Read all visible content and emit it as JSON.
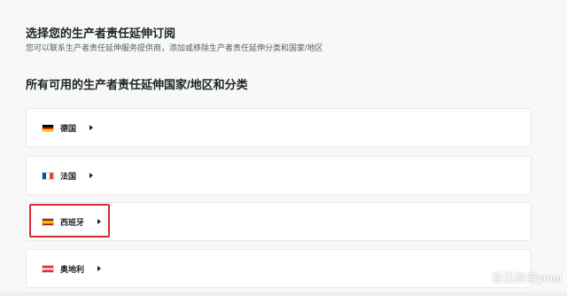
{
  "header": {
    "title": "选择您的生产者责任延伸订阅",
    "subtitle": "您可以联系生产者责任延伸服务提供商，添加或移除生产者责任延伸分类和国家/地区"
  },
  "section": {
    "title": "所有可用的生产者责任延伸国家/地区和分类"
  },
  "countries": [
    {
      "label": "德国",
      "flag": "germany-flag-icon"
    },
    {
      "label": "法国",
      "flag": "france-flag-icon"
    },
    {
      "label": "西班牙",
      "flag": "spain-flag-icon"
    },
    {
      "label": "奥地利",
      "flag": "austria-flag-icon"
    }
  ],
  "colors": {
    "background": "#f7f8f8",
    "card": "#ffffff",
    "highlight": "#d42b2b",
    "text": "#1d2226"
  },
  "watermark": {
    "text": "易迈商务ymai",
    "icon": "wechat-icon"
  }
}
